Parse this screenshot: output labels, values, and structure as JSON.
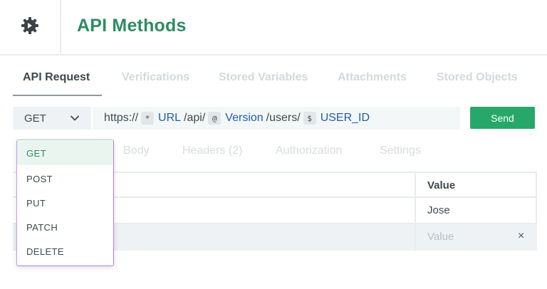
{
  "header": {
    "title": "API Methods",
    "icon": "gear-icon"
  },
  "tabs": [
    {
      "label": "API Request",
      "active": true
    },
    {
      "label": "Verifications",
      "active": false
    },
    {
      "label": "Stored Variables",
      "active": false
    },
    {
      "label": "Attachments",
      "active": false
    },
    {
      "label": "Stored Objects",
      "active": false
    }
  ],
  "request": {
    "method": "GET",
    "url_parts": {
      "prefix": "https://",
      "tok1": "*",
      "var1": "URL",
      "mid1": "/api/",
      "tok2": "@",
      "var2": "Version",
      "mid2": "/users/",
      "tok3": "$",
      "var3": "USER_ID"
    },
    "send_label": "Send"
  },
  "subtabs": [
    "Body",
    "Headers (2)",
    "Authorization",
    "Settings"
  ],
  "table": {
    "value_header": "Value",
    "rows": [
      {
        "value": "Jose"
      }
    ],
    "new_row_placeholder": "Value",
    "remove_symbol": "×"
  },
  "dropdown": {
    "options": [
      "GET",
      "POST",
      "PUT",
      "PATCH",
      "DELETE"
    ],
    "selected": "GET"
  },
  "colors": {
    "brand": "#2e8b66",
    "send": "#27a86a",
    "variable": "#1f5ea8"
  }
}
